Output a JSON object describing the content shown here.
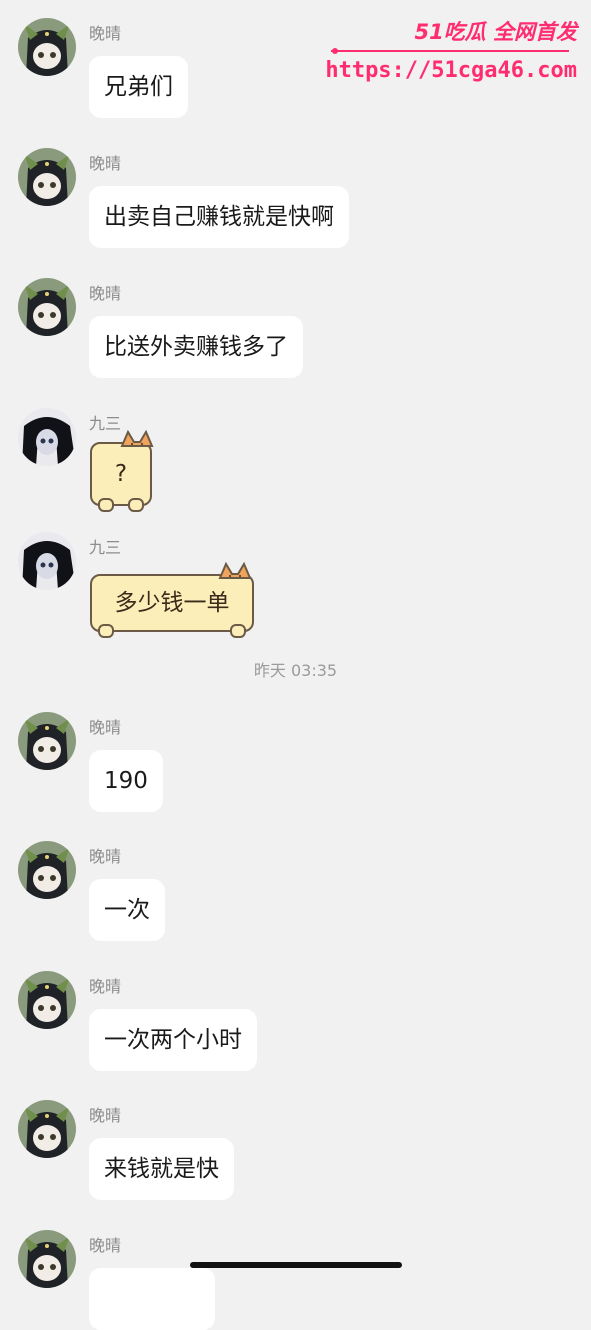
{
  "watermark": {
    "brand": "51吃瓜 全网首发",
    "url": "https://51cga46.com"
  },
  "timestamp": "昨天 03:35",
  "messages": [
    {
      "sender": "晚晴",
      "text": "兄弟们"
    },
    {
      "sender": "晚晴",
      "text": "出卖自己赚钱就是快啊"
    },
    {
      "sender": "晚晴",
      "text": "比送外卖赚钱多了"
    },
    {
      "sender": "九三",
      "text": "?"
    },
    {
      "sender": "九三",
      "text": "多少钱一单"
    },
    {
      "sender": "晚晴",
      "text": "190"
    },
    {
      "sender": "晚晴",
      "text": "一次"
    },
    {
      "sender": "晚晴",
      "text": "一次两个小时"
    },
    {
      "sender": "晚晴",
      "text": "来钱就是快"
    },
    {
      "sender": "晚晴",
      "text": ""
    }
  ],
  "colors": {
    "background": "#f1f1f1",
    "bubble": "#ffffff",
    "cat_bubble": "#fbeeb9",
    "watermark": "#ff2d6f"
  },
  "icons": {
    "avatar_wanqing": "anime-girl-avatar",
    "avatar_jiusan": "dark-hair-avatar",
    "cat_bubble": "cat-ears-bubble"
  }
}
